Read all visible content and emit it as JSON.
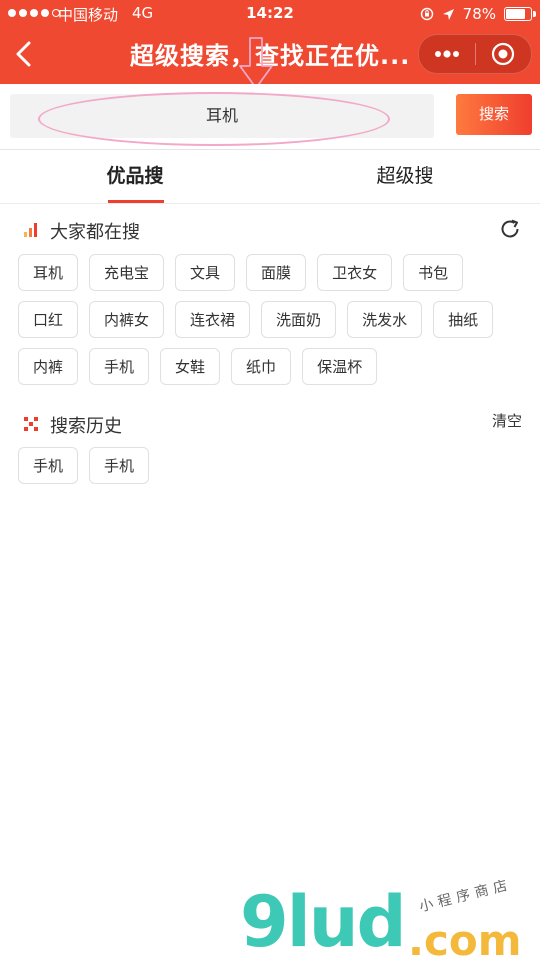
{
  "status_bar": {
    "carrier": "中国移动",
    "network": "4G",
    "time": "14:22",
    "battery": "78%",
    "battery_level": 0.78
  },
  "nav": {
    "title": "超级搜索，查找正在优..."
  },
  "search": {
    "value": "耳机",
    "button": "搜索"
  },
  "tabs": [
    {
      "label": "优品搜",
      "active": true
    },
    {
      "label": "超级搜",
      "active": false
    }
  ],
  "hot": {
    "title": "大家都在搜",
    "tags": [
      "耳机",
      "充电宝",
      "文具",
      "面膜",
      "卫衣女",
      "书包",
      "口红",
      "内裤女",
      "连衣裙",
      "洗面奶",
      "洗发水",
      "抽纸",
      "内裤",
      "手机",
      "女鞋",
      "纸巾",
      "保温杯"
    ]
  },
  "history": {
    "title": "搜索历史",
    "clear": "清空",
    "tags": [
      "手机",
      "手机"
    ]
  },
  "watermark": {
    "main": "9lud",
    "suffix": ".com",
    "sub": "小程序商店"
  },
  "colors": {
    "brand_red": "#ef4931",
    "button_orange": "#fe7a3f",
    "watermark_teal": "#3ec9b7",
    "watermark_yellow": "#f4b83b"
  }
}
